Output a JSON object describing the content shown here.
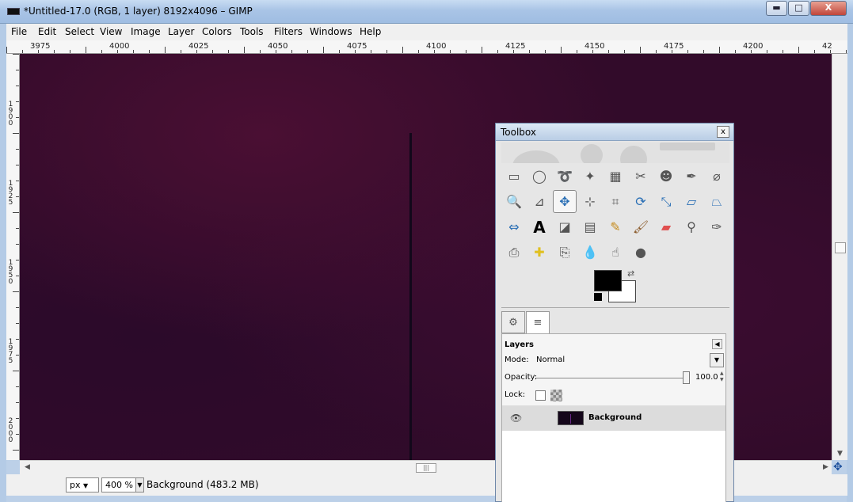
{
  "window": {
    "title": "*Untitled-17.0 (RGB, 1 layer) 8192x4096 – GIMP",
    "minimize": "▬",
    "maximize": "□",
    "close": "X"
  },
  "menu": [
    "File",
    "Edit",
    "Select",
    "View",
    "Image",
    "Layer",
    "Colors",
    "Tools",
    "Filters",
    "Windows",
    "Help"
  ],
  "hruler_labels": [
    "3975",
    "4000",
    "4025",
    "4050",
    "4075",
    "4100",
    "4125",
    "4150",
    "4175",
    "4200",
    "42"
  ],
  "vruler_labels": [
    "1900",
    "1925",
    "1950",
    "1975",
    "2000"
  ],
  "statusbar": {
    "unit": "px",
    "zoom": "400 %",
    "status": "Background (483.2 MB)"
  },
  "toolbox": {
    "title": "Toolbox",
    "close": "x",
    "tool_icons": [
      "rect-select-icon",
      "ellipse-select-icon",
      "free-select-icon",
      "fuzzy-select-icon",
      "color-select-icon",
      "scissors-icon",
      "foreground-select-icon",
      "paths-icon",
      "color-picker-icon",
      "zoom-icon",
      "measure-icon",
      "move-icon",
      "align-icon",
      "crop-icon",
      "rotate-icon",
      "scale-icon",
      "shear-icon",
      "perspective-icon",
      "flip-icon",
      "text-icon",
      "bucket-fill-icon",
      "blend-icon",
      "pencil-icon",
      "paintbrush-icon",
      "eraser-icon",
      "airbrush-icon",
      "ink-icon",
      "clone-icon",
      "heal-icon",
      "perspective-clone-icon",
      "blur-icon",
      "smudge-icon",
      "dodge-burn-icon"
    ],
    "active_tool": "move-icon",
    "fg_color": "#000000",
    "bg_color": "#ffffff"
  },
  "layers": {
    "title": "Layers",
    "mode_label": "Mode:",
    "mode": "Normal",
    "opacity_label": "Opacity:",
    "opacity": "100.0",
    "lock_label": "Lock:",
    "items": [
      {
        "name": "Background",
        "visible": true
      }
    ]
  }
}
